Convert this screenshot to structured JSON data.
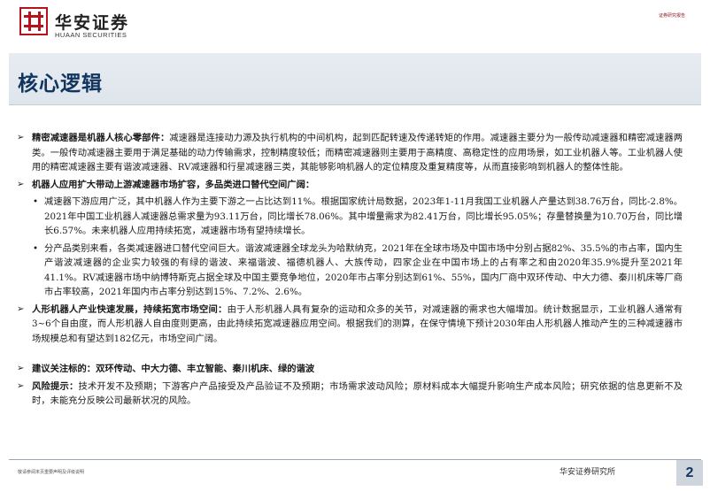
{
  "header": {
    "logo_cn": "华安证券",
    "logo_en": "HUAAN SECURITIES",
    "doc_type": "证券研究报告"
  },
  "page_title": "核心逻辑",
  "sections": [
    {
      "lead": "精密减速器是机器人核心零部件：",
      "text": "减速器是连接动力源及执行机构的中间机构，起到匹配转速及传递转矩的作用。减速器主要分为一般传动减速器和精密减速器两类。一般传动减速器主要用于满足基础的动力传输需求，控制精度较低；而精密减速器则主要用于高精度、高稳定性的应用场景，如工业机器人等。工业机器人使用的精密减速器主要有谐波减速器、RV减速器和行星减速器三类，其能够影响机器人的定位精度及重复精度等，从而直接影响到机器人的整体性能。"
    },
    {
      "lead": "机器人应用扩大带动上游减速器市场扩容，多品类进口替代空间广阔：",
      "text": "",
      "subs": [
        "减速器下游应用广泛，其中机器人作为主要下游之一占比达到11%。根据国家统计局数据，2023年1-11月我国工业机器人产量达到38.76万台，同比-2.8%。2021年中国工业机器人减速器总需求量为93.11万台，同比增长78.06%。其中增量需求为82.41万台，同比增长95.05%；存量替换量为10.70万台，同比增长6.57%。未来机器人应用持续拓宽，减速器市场有望持续增长。",
        "分产品类别来看，各类减速器进口替代空间巨大。谐波减速器全球龙头为哈默纳克，2021年在全球市场及中国市场中分别占据82%、35.5%的市占率，国内生产谐波减速器的企业实力较强的有绿的谐波、来福谐波、福德机器人、大族传动，四家企业在中国市场上的占有率之和由2020年35.9%提升至2021年41.1%。RV减速器市场中纳博特斯克占据全球及中国主要竞争地位，2020年市占率分别达到61%、55%，国内厂商中双环传动、中大力德、秦川机床等厂商市占率较高，2021年国内市占率分别达到15%、7.2%、2.6%。"
      ]
    },
    {
      "lead": "人形机器人产业快速发展，持续拓宽市场空间：",
      "text": "由于人形机器人具有复杂的运动和众多的关节，对减速器的需求也大幅增加。统计数据显示，工业机器人通常有3~6个自由度，而人形机器人自由度则更高，由此持续拓宽减速器应用空间。根据我们的测算，在保守情境下预计2030年由人形机器人推动产生的三种减速器市场规模总和有望达到182亿元，市场空间广阔。"
    },
    {
      "lead": "建议关注标的：",
      "text": "双环传动、中大力德、丰立智能、秦川机床、绿的谐波",
      "text_bold": true
    },
    {
      "lead": "风险提示：",
      "text": "技术开发不及预期；下游客户产品接受及产品验证不及预期；市场需求波动风险；原材料成本大幅提升影响生产成本风险；研究依据的信息更新不及时，未能充分反映公司最新状况的风险。"
    }
  ],
  "footer": {
    "disclaimer": "敬请参阅末页重要声明及评级说明",
    "org": "华安证券研究所",
    "page_number": "2"
  },
  "colors": {
    "brand_red": "#b5121b",
    "title_navy": "#12355f",
    "band_bg": "#e3e8ee"
  }
}
